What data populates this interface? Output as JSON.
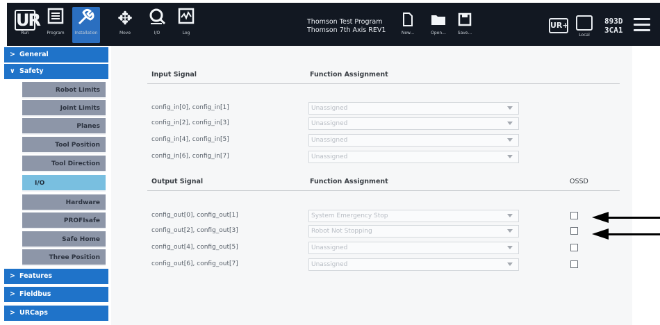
{
  "topbar": {
    "buttons": {
      "run": "Run",
      "program": "Program",
      "installation": "Installation",
      "move": "Move",
      "io": "I/O",
      "log": "Log",
      "new": "New...",
      "open": "Open...",
      "save": "Save..."
    },
    "program_name": "Thomson Test Program",
    "installation_name": "Thomson 7th Axis REV1",
    "local_label": "Local",
    "serial_line1": "893D",
    "serial_line2": "3CA1"
  },
  "sidebar": {
    "general": "General",
    "safety": "Safety",
    "safety_items": [
      "Robot Limits",
      "Joint Limits",
      "Planes",
      "Tool Position",
      "Tool Direction",
      "I/O",
      "Hardware",
      "PROFIsafe",
      "Safe Home",
      "Three Position"
    ],
    "features": "Features",
    "fieldbus": "Fieldbus",
    "urcaps": "URCaps"
  },
  "inputs": {
    "header_signal": "Input Signal",
    "header_function": "Function Assignment",
    "rows": [
      {
        "signal": "config_in[0], config_in[1]",
        "value": "Unassigned"
      },
      {
        "signal": "config_in[2], config_in[3]",
        "value": "Unassigned"
      },
      {
        "signal": "config_in[4], config_in[5]",
        "value": "Unassigned"
      },
      {
        "signal": "config_in[6], config_in[7]",
        "value": "Unassigned"
      }
    ]
  },
  "outputs": {
    "header_signal": "Output Signal",
    "header_function": "Function Assignment",
    "header_ossd": "OSSD",
    "rows": [
      {
        "signal": "config_out[0], config_out[1]",
        "value": "System Emergency Stop",
        "ossd": false
      },
      {
        "signal": "config_out[2], config_out[3]",
        "value": "Robot Not Stopping",
        "ossd": false
      },
      {
        "signal": "config_out[4], config_out[5]",
        "value": "Unassigned",
        "ossd": false
      },
      {
        "signal": "config_out[6], config_out[7]",
        "value": "Unassigned",
        "ossd": false
      }
    ]
  },
  "colors": {
    "topbar": "#121822",
    "accent_blue": "#1f73c9",
    "submenu": "#8d96a8",
    "submenu_active": "#79bfe0"
  }
}
